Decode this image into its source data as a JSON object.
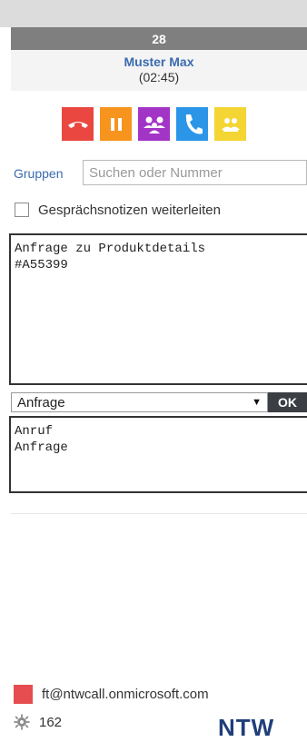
{
  "call": {
    "counter": "28",
    "caller_name": "Muster Max",
    "duration": "(02:45)"
  },
  "actions": [
    {
      "name": "hangup-icon",
      "color": "#e9473f"
    },
    {
      "name": "pause-icon",
      "color": "#f7941d"
    },
    {
      "name": "conference-icon",
      "color": "#a234c6"
    },
    {
      "name": "phone-icon",
      "color": "#2b95e8"
    },
    {
      "name": "contacts-icon",
      "color": "#f4d533"
    }
  ],
  "search": {
    "groups_label": "Gruppen",
    "placeholder": "Suchen oder Nummer"
  },
  "forward": {
    "label": "Gesprächsnotizen weiterleiten",
    "checked": false
  },
  "notes": {
    "text": "Anfrage zu Produktdetails\n#A55399"
  },
  "category": {
    "selected": "Anfrage",
    "ok_label": "OK",
    "options": [
      "Anruf",
      "Anfrage"
    ]
  },
  "footer": {
    "status_color": "#e54d50",
    "email": "ft@ntwcall.onmicrosoft.com",
    "extension": "162",
    "logo": "NTW"
  }
}
